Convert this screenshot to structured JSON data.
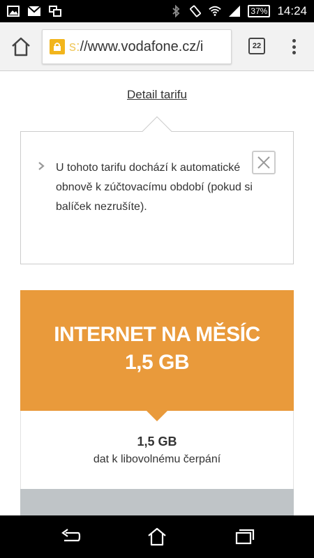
{
  "status_bar": {
    "left_icons": [
      "image-icon",
      "gmail-icon",
      "screen-icon"
    ],
    "right_icons": [
      "bluetooth-icon",
      "rotation-icon",
      "wifi-icon",
      "signal-icon"
    ],
    "battery": "37%",
    "time": "14:24"
  },
  "browser": {
    "url_faded": "s:",
    "url": "//www.vodafone.cz/i",
    "tab_count": "22",
    "accent_color": "#f2b51c"
  },
  "page": {
    "detail_link": "Detail tarifu",
    "info_text": "U tohoto tarifu dochází k automatické obnově k zúčtovacímu období (pokud si balíček nezrušíte).",
    "card": {
      "title_line1": "INTERNET NA MĚSÍC",
      "title_line2": "1,5 GB",
      "amount": "1,5 GB",
      "description": "dat k libovolnému čerpání",
      "header_color": "#e99a3b"
    }
  },
  "nav_bar": {
    "buttons": [
      "back-icon",
      "home-icon",
      "recents-icon"
    ]
  }
}
